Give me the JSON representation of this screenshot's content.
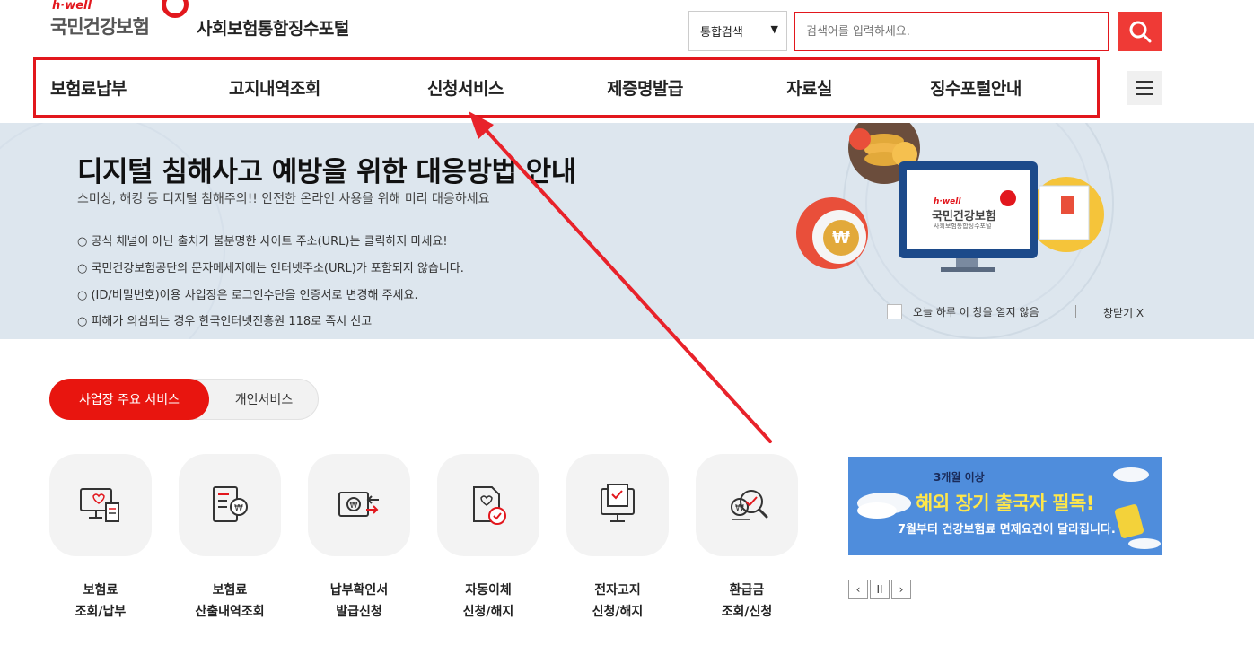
{
  "header": {
    "logo_small": "h·well",
    "logo_org": "국민건강보험",
    "portal_title": "사회보험통합징수포털",
    "search_select": "통합검색",
    "search_placeholder": "검색어를 입력하세요."
  },
  "nav": {
    "items": [
      "보험료납부",
      "고지내역조회",
      "신청서비스",
      "제증명발급",
      "자료실",
      "징수포털안내"
    ]
  },
  "banner": {
    "title": "디지털 침해사고 예방을 위한 대응방법 안내",
    "subtitle": "스미싱, 해킹 등 디지털 침해주의!! 안전한 온라인 사용을 위해 미리 대응하세요",
    "notices": [
      "○ 공식 채널이 아닌 출처가 불분명한 사이트 주소(URL)는 클릭하지 마세요!",
      "○ 국민건강보험공단의 문자메세지에는 인터넷주소(URL)가 포함되지 않습니다.",
      "○ (ID/비밀번호)이용 사업장은 로그인수단을 인증서로 변경해 주세요.",
      "○ 피해가 의심되는 경우 한국인터넷진흥원 118로 즉시 신고"
    ],
    "monitor_small": "h·well",
    "monitor_org": "국민건강보험",
    "monitor_sub": "사회보험통합징수포털",
    "dont_show": "오늘 하루 이 창을 열지 않음",
    "close": "창닫기 X"
  },
  "tabs": {
    "active": "사업장 주요 서비스",
    "inactive": "개인서비스"
  },
  "services": [
    {
      "line1": "보험료",
      "line2": "조회/납부",
      "icon": "monitor-receipt-icon"
    },
    {
      "line1": "보험료",
      "line2": "산출내역조회",
      "icon": "document-won-icon"
    },
    {
      "line1": "납부확인서",
      "line2": "발급신청",
      "icon": "won-transfer-icon"
    },
    {
      "line1": "자동이체",
      "line2": "신청/해지",
      "icon": "document-check-icon"
    },
    {
      "line1": "전자고지",
      "line2": "신청/해지",
      "icon": "monitor-check-icon"
    },
    {
      "line1": "환급금",
      "line2": "조회/신청",
      "icon": "won-search-icon"
    }
  ],
  "ad": {
    "line1": "3개월 이상",
    "line2": "해외 장기 출국자 필독!",
    "line3": "7월부터 건강보험료 면제요건이 달라집니다."
  },
  "ad_controls": {
    "prev": "‹",
    "pause": "II",
    "next": "›"
  },
  "colors": {
    "accent_red": "#e2171d",
    "banner_bg": "#dde6ee",
    "ad_bg": "#4f8ddc"
  }
}
